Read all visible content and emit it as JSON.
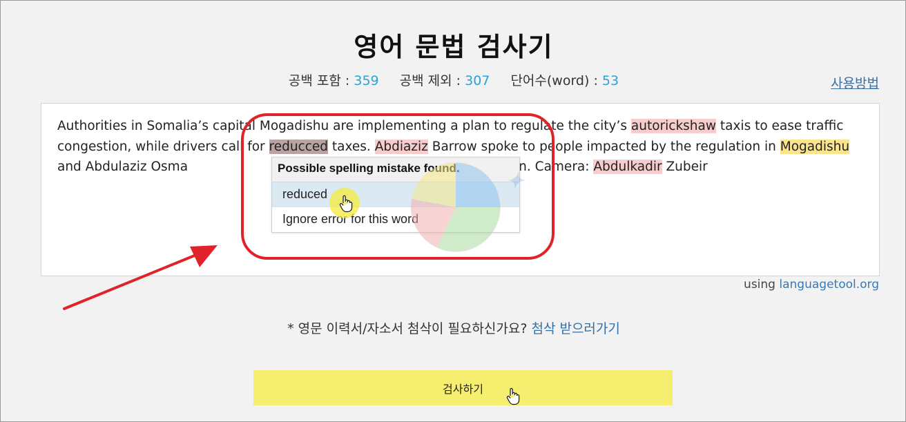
{
  "title": "영어 문법 검사기",
  "stats": {
    "with_spaces_label": "공백 포함 :",
    "with_spaces_value": "359",
    "without_spaces_label": "공백 제외 :",
    "without_spaces_value": "307",
    "words_label": "단어수(word) :",
    "words_value": "53"
  },
  "help_link": "사용방법",
  "editor": {
    "t1": "Authorities in Somalia’s capital Mogadishu are implementing a plan to regulate the city’s ",
    "e1": "autorickshaw",
    "t2": " taxis to ease traffic congestion, while drivers call for ",
    "e2": "reducced",
    "t3": " taxes. ",
    "e3": "Abdiaziz",
    "t4": " Barrow spoke to people impacted by the regulation in ",
    "e4": "Mogadishu",
    "t5": " and Abdulaziz Osma",
    "t6": "is narrated by Salem Solomon. Camera: ",
    "e5": "Abdulkadir",
    "t7": " Zubeir"
  },
  "popup": {
    "header": "Possible spelling mistake found.",
    "suggestion": "reduced",
    "ignore": "Ignore error for this word"
  },
  "using_label": "using ",
  "using_link": "languagetool.org",
  "promo_text": "* 영문 이력서/자소서 첨삭이 필요하신가요? ",
  "promo_link": "첨삭 받으러가기",
  "check_button": "검사하기",
  "colors": {
    "accent_number": "#29a3d6",
    "spelling_error": "#f6cccc",
    "style_warning": "#fbe58c",
    "button": "#f5ee6e",
    "annotation": "#e0232b"
  }
}
